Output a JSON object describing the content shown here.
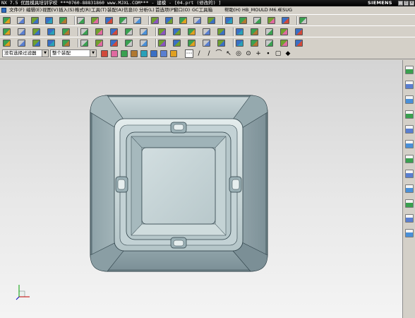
{
  "window": {
    "title": "NX 7.5 优胜模具培训学校 ***0760-88831860 www.MJXL.COM*** - 建模 - [04.prt (修改的) ]",
    "brand": "SIEMENS",
    "controls": [
      "_",
      "□",
      "x"
    ]
  },
  "menu": {
    "items": [
      "文件(F)",
      "编辑(E)",
      "视图(V)",
      "插入(S)",
      "格式(R)",
      "工具(T)",
      "装配(A)",
      "信息(I)",
      "分析(L)",
      "首选项(P)",
      "窗口(O)",
      "GC工具箱",
      "帮助(H)",
      "HB_MOULD M6.6",
      "ESUG"
    ]
  },
  "selection_bar": {
    "filter": "没有选择过滤器",
    "scope": "整个装配"
  },
  "toolbars": {
    "row1_icons": [
      "select-icon",
      "undo-icon",
      "redo-icon",
      "cut-icon",
      "copy-icon",
      "paste-icon",
      "delete-icon",
      "snap-view-icon",
      "zoom-icon",
      "pan-icon",
      "rotate-icon",
      "fit-icon",
      "shaded-icon",
      "wireframe-icon",
      "layer-icon",
      "measure-icon",
      "section-icon",
      "view-orient-icon",
      "render-icon",
      "camera-icon",
      "light-icon"
    ],
    "row2_icons": [
      "sketch-icon",
      "extrude-icon",
      "revolve-icon",
      "hole-icon",
      "boss-icon",
      "pocket-icon",
      "pad-icon",
      "slot-icon",
      "groove-icon",
      "edge-blend-icon",
      "chamfer-icon",
      "shell-icon",
      "draft-icon",
      "trim-body-icon",
      "unite-icon",
      "subtract-icon",
      "intersect-icon",
      "pattern-icon",
      "mirror-icon",
      "offset-face-icon"
    ],
    "row3_icons": [
      "point-icon",
      "line-icon",
      "arc-icon",
      "rectangle-icon",
      "text-icon",
      "spline-icon",
      "curve-icon",
      "project-icon",
      "offset-curve-icon",
      "bridge-icon",
      "surface-icon",
      "sew-icon",
      "thicken-icon",
      "face-icon",
      "through-curves-icon",
      "studio-surface-icon",
      "extract-icon",
      "trim-sheet-icon",
      "divide-face-icon",
      "blend-icon"
    ],
    "snap_icons": [
      "snap-select-icon",
      "snap-end-icon",
      "snap-line-icon",
      "snap-arc-icon",
      "snap-tangent-icon",
      "snap-center-icon",
      "snap-quadrant-icon",
      "snap-cross-icon",
      "snap-point-icon",
      "snap-face-icon",
      "snap-cube-icon"
    ]
  },
  "resource_bar": {
    "icons": [
      "assembly-navigator-icon",
      "constraint-navigator-icon",
      "part-navigator-icon",
      "reuse-library-icon",
      "internet-icon",
      "history-icon",
      "system-materials-icon",
      "process-studio-icon",
      "roles-icon",
      "hd3d-tools-icon",
      "palette-icon",
      "system-scene-icon"
    ]
  },
  "colors": {
    "titlebar": "#000000",
    "chrome": "#d4d0c8",
    "model_dark": "#7f949c",
    "model_mid": "#a9bcc1",
    "model_light": "#d4e0e1",
    "model_edge": "#2a3d44"
  }
}
